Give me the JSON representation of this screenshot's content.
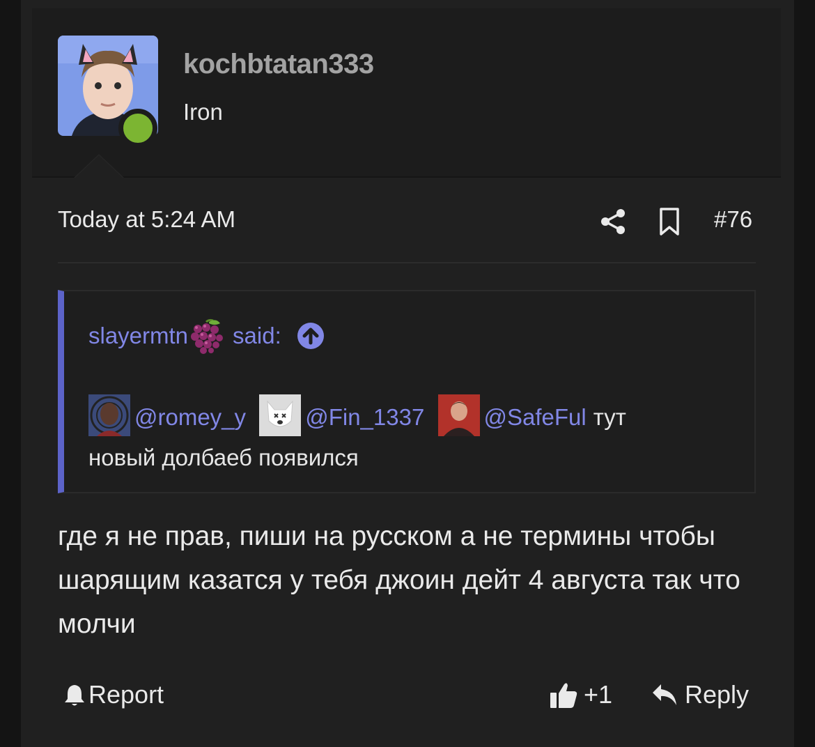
{
  "author": {
    "username": "kochbtatan333",
    "title": "Iron",
    "online": true
  },
  "post": {
    "date": "Today at 5:24 AM",
    "number": "#76",
    "icons": [
      "share-icon",
      "bookmark-icon"
    ]
  },
  "quote": {
    "author": "slayermtn",
    "author_emoji": "grapes-emoji",
    "said_label": "said:",
    "mentions": [
      {
        "handle": "@romey_y"
      },
      {
        "handle": "@Fin_1337"
      },
      {
        "handle": "@SafeFul"
      }
    ],
    "text_inline": "тут",
    "text_rest": "новый долбаеб появился"
  },
  "message": {
    "text": "где я не прав, пиши на русском а не термины чтобы шарящим казатся у тебя джоин дейт 4 августа так что молчи"
  },
  "footer": {
    "report_label": "Report",
    "like_count": "+1",
    "reply_label": "Reply"
  },
  "colors": {
    "accent": "#5c63c9",
    "link": "#8187e6",
    "online": "#7cb532",
    "background": "#202020"
  }
}
